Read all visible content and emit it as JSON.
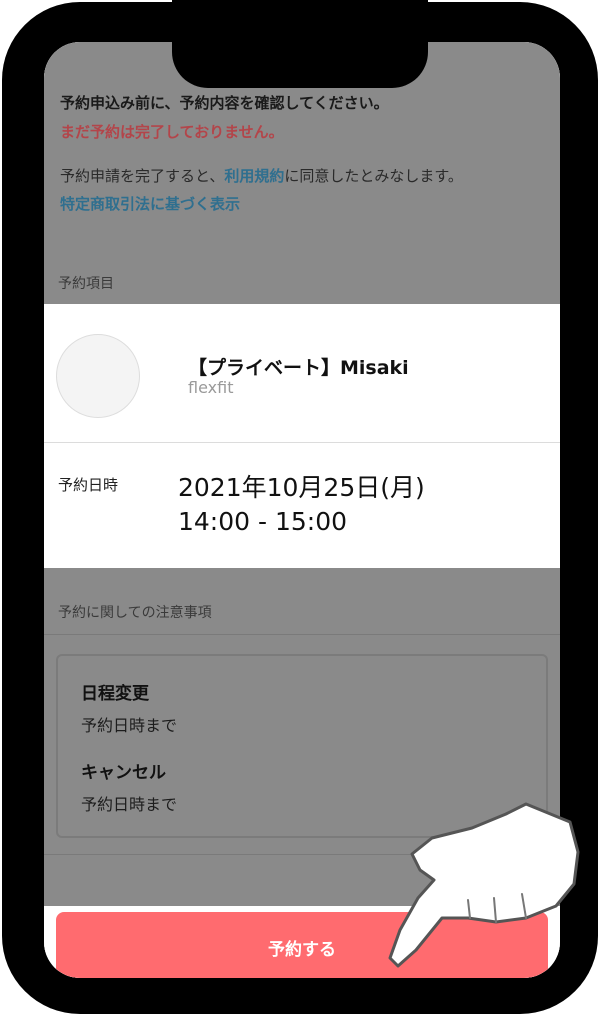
{
  "notice": {
    "line1": "予約申込み前に、予約内容を確認してください。",
    "line2": "まだ予約は完了しておりません。"
  },
  "terms": {
    "prefix": "予約申請を完了すると、",
    "link_label": "利用規約",
    "suffix": "に同意したとみなします。",
    "law_link": "特定商取引法に基づく表示"
  },
  "booking": {
    "section_label": "予約項目",
    "trainer_name": "【プライベート】Misaki",
    "trainer_org": "flexfit",
    "datetime_label": "予約日時",
    "date": "2021年10月25日(月)",
    "time": "14:00 - 15:00"
  },
  "notes": {
    "section_label": "予約に関しての注意事項",
    "items": [
      {
        "title": "日程変更",
        "text": "予約日時まで"
      },
      {
        "title": "キャンセル",
        "text": "予約日時まで"
      }
    ]
  },
  "actions": {
    "reserve_label": "予約する"
  },
  "colors": {
    "accent": "#ff6b6f",
    "warning": "#b3454a",
    "link": "#2f6f8f",
    "overlay": "#8a8a8a"
  },
  "icons": {
    "pointer": "pointing-hand-icon"
  }
}
